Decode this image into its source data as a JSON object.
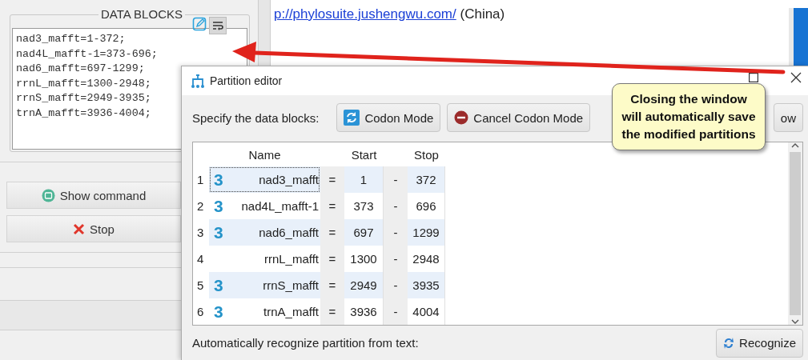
{
  "background_window": {
    "group_title": "DATA BLOCKS",
    "data_blocks_text": [
      "nad3_mafft=1-372;",
      "nad4L_mafft-1=373-696;",
      "nad6_mafft=697-1299;",
      "rrnL_mafft=1300-2948;",
      "rrnS_mafft=2949-3935;",
      "trnA_mafft=3936-4004;"
    ],
    "wrap_selected": true,
    "buttons": [
      {
        "label": "Show command",
        "kind": "command"
      },
      {
        "label": "Stop",
        "kind": "stop"
      }
    ],
    "link": {
      "url_text": "p://phylosuite.jushengwu.com/",
      "suffix": "(China)"
    }
  },
  "dialog": {
    "title": "Partition editor",
    "toolbar_label": "Specify the data blocks:",
    "buttons": [
      {
        "label": "Codon Mode",
        "kind": "codon"
      },
      {
        "label": "Cancel Codon Mode",
        "kind": "cancel"
      },
      {
        "label": "ow",
        "kind": "plain"
      }
    ],
    "table": {
      "columns": [
        "Name",
        "Start",
        "Stop"
      ],
      "rows": [
        {
          "index": "1",
          "codon": "3",
          "name": "nad3_mafft",
          "equals": "=",
          "start": "1",
          "dash": "-",
          "stop": "372",
          "selected": true
        },
        {
          "index": "2",
          "codon": "3",
          "name": "nad4L_mafft-1",
          "equals": "=",
          "start": "373",
          "dash": "-",
          "stop": "696",
          "selected": false
        },
        {
          "index": "3",
          "codon": "3",
          "name": "nad6_mafft",
          "equals": "=",
          "start": "697",
          "dash": "-",
          "stop": "1299",
          "selected": false
        },
        {
          "index": "4",
          "name": "rrnL_mafft",
          "equals": "=",
          "start": "1300",
          "dash": "-",
          "stop": "2948",
          "selected": false
        },
        {
          "index": "5",
          "codon": "3",
          "name": "rrnS_mafft",
          "equals": "=",
          "start": "2949",
          "dash": "-",
          "stop": "3935",
          "selected": false
        },
        {
          "index": "6",
          "codon": "3",
          "name": "trnA_mafft",
          "equals": "=",
          "start": "3936",
          "dash": "-",
          "stop": "4004",
          "selected": false
        }
      ]
    },
    "recognize_label": "Automatically recognize partition from text:",
    "recognize_button": "Recognize"
  },
  "callout": {
    "text": "Closing the window will automatically save the modified partitions"
  }
}
